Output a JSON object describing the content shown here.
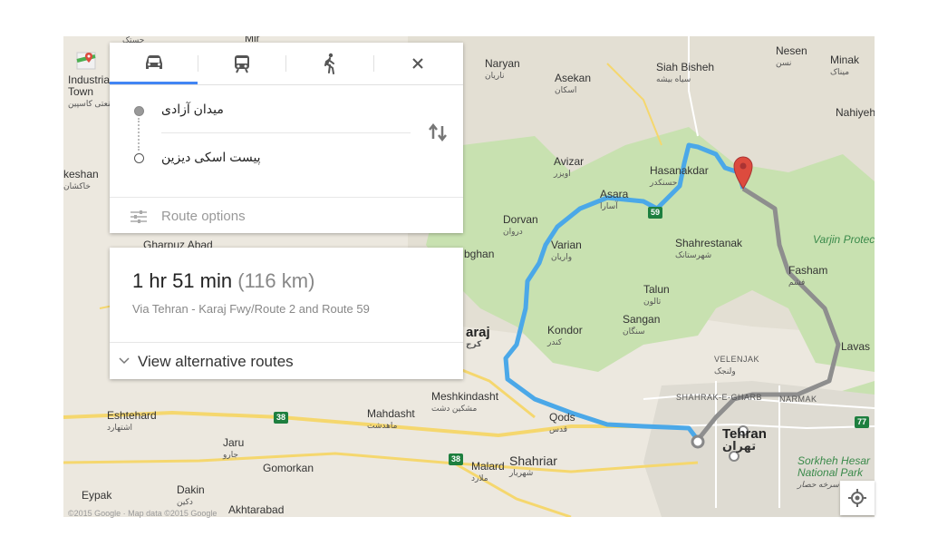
{
  "modes": {
    "driving_icon": "car-icon",
    "transit_icon": "train-icon",
    "walking_icon": "walk-icon",
    "close_icon": "close-icon"
  },
  "waypoints": {
    "origin": "میدان آزادی",
    "destination": "پیست اسکی دیزین"
  },
  "route_options_label": "Route options",
  "summary": {
    "hours": "1",
    "hr_unit": "hr",
    "minutes": "51",
    "min_unit": "min",
    "distance": "(116 km)",
    "via": "Via Tehran - Karaj Fwy/Route 2 and Route 59"
  },
  "alternatives_label": "View alternative routes",
  "copyright": "©2015 Google · Map data ©2015 Google",
  "colors": {
    "route": "#4ba8e8",
    "alt_route": "#8e8e8e",
    "accent": "#4285f4",
    "park": "#c8e1b0",
    "road": "#f5d76e",
    "marker": "#dd4b3e"
  },
  "labels": {
    "naryan": "Naryan",
    "naryan_fa": "ناریان",
    "asekan": "Asekan",
    "asekan_fa": "اسکان",
    "siah_bisheh": "Siah Bisheh",
    "siah_bisheh_fa": "سیاه بیشه",
    "nesen": "Nesen",
    "nesen_fa": "نسن",
    "minak": "Minak",
    "minak_fa": "میناک",
    "nahiyeh": "Nahiyeh",
    "industrial": "Industrial",
    "town": "Town",
    "industrial_fa": "شهرک صنعتی کاسپین",
    "keshan": "keshan",
    "keshan_fa": "خاکشان",
    "avizar": "Avizar",
    "avizar_fa": "اویزر",
    "hasanakdar": "Hasanakdar",
    "hasanakdar_fa": "حسنکدر",
    "asara": "Asara",
    "asara_fa": "آسارا",
    "dorvan": "Dorvan",
    "dorvan_fa": "دروان",
    "varian": "Varian",
    "varian_fa": "واریان",
    "shahrestanak": "Shahrestanak",
    "shahrestanak_fa": "شهرستانک",
    "varjin": "Varjin Protec",
    "fasham": "Fasham",
    "fasham_fa": "فشم",
    "talun": "Talun",
    "talun_fa": "تالون",
    "sangan": "Sangan",
    "sangan_fa": "سنگان",
    "kondor": "Kondor",
    "kondor_fa": "کندر",
    "karaj": "araj",
    "karaj_fa": "کرج",
    "gharpuz": "Gharpuz Abad",
    "bghan": "bghan",
    "lavas": "Lavas",
    "velenjak": "VELENJAK",
    "velenjak_fa": "ولنجک",
    "shahrak": "SHAHRAK-E-GHARB",
    "narmak": "NARMAK",
    "meshkin": "Meshkindasht",
    "meshkin_fa": "مشکین دشت",
    "eshtehard": "Eshtehard",
    "eshtehard_fa": "اشتهارد",
    "mahdasht": "Mahdasht",
    "mahdasht_fa": "ماهدشت",
    "qods": "Qods",
    "qods_fa": "قدس",
    "tehran": "Tehran",
    "tehran_fa": "تهران",
    "jaru": "Jaru",
    "jaru_fa": "جارو",
    "gomorkan": "Gomorkan",
    "malard": "Malard",
    "malard_fa": "ملارد",
    "shahriar": "Shahriar",
    "shahriar_fa": "شهریار",
    "eypak": "Eypak",
    "dakin": "Dakin",
    "dakin_fa": "دکین",
    "akhtarabad": "Akhtarabad",
    "sorkheh": "Sorkheh Hesar",
    "sorkheh2": "National Park",
    "sorkheh_fa": "سرخه حصار",
    "mir": "Mir",
    "top_fa": "چستک"
  },
  "shields": {
    "r59": "59",
    "r38a": "38",
    "r38b": "38",
    "r77": "77"
  }
}
